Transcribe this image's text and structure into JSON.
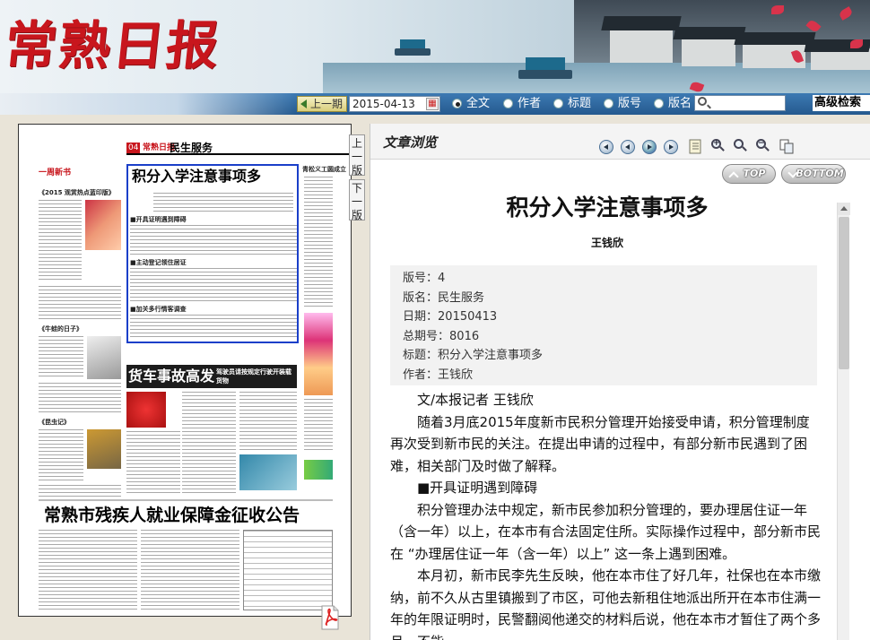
{
  "site": {
    "logo": "常熟日报",
    "colors": {
      "brand_red": "#c8161d",
      "toolbar_blue": "#25598e",
      "selection_blue": "#1a3fc9"
    }
  },
  "toolbar": {
    "prev_issue": "上一期",
    "date_value": "2015-04-13",
    "search_options": [
      "全文",
      "作者",
      "标题",
      "版号",
      "版名"
    ],
    "selected_option": "全文",
    "search_value": "",
    "advanced_search": "高级检索"
  },
  "page_nav": {
    "prev_page": "上一版",
    "next_page": "下一版"
  },
  "newspaper_page": {
    "page_number": "04",
    "paper_name": "常熟日报",
    "section": "民生服务",
    "selected_article_title": "积分入学注意事项多",
    "sub_heads": [
      "■开具证明遇到障碍",
      "■主动登记领住居证",
      "■加关多行情客调查"
    ],
    "side_heads": [
      "一周新书",
      "《2015 观赏热点蓝印版》",
      "《牛蛙的日子》",
      "《昆虫记》"
    ],
    "right_head": "青松义工圆成立",
    "accident_head": "货车事故高发",
    "accident_sub": "驾驶员请按规定行驶开装载货物",
    "notice_head": "常熟市残疾人就业保障金征收公告"
  },
  "article_view": {
    "panel_title": "文章浏览",
    "top_button": "TOP",
    "bottom_button": "BOTTOM",
    "title": "积分入学注意事项多",
    "author": "王钱欣",
    "meta": [
      {
        "label": "版号",
        "value": "4"
      },
      {
        "label": "版名",
        "value": "民生服务"
      },
      {
        "label": "日期",
        "value": "20150413"
      },
      {
        "label": "总期号",
        "value": "8016"
      },
      {
        "label": "标题",
        "value": "积分入学注意事项多"
      },
      {
        "label": "作者",
        "value": "王钱欣"
      }
    ],
    "paragraphs": [
      "文/本报记者 王钱欣",
      "随着3月底2015年度新市民积分管理开始接受申请，积分管理制度再次受到新市民的关注。在提出申请的过程中，有部分新市民遇到了困难，相关部门及时做了解释。",
      "■开具证明遇到障碍",
      "积分管理办法中规定，新市民参加积分管理的，要办理居住证一年（含一年）以上，在本市有合法固定住所。实际操作过程中，部分新市民在 “办理居住证一年（含一年）以上” 这一条上遇到困难。",
      "本月初，新市民李先生反映，他在本市住了好几年，社保也在本市缴纳，前不久从古里镇搬到了市区，可他去新租住地派出所开在本市住满一年的年限证明时，民警翻阅他递交的材料后说，他在本市才暂住了两个多月，不能"
    ]
  }
}
